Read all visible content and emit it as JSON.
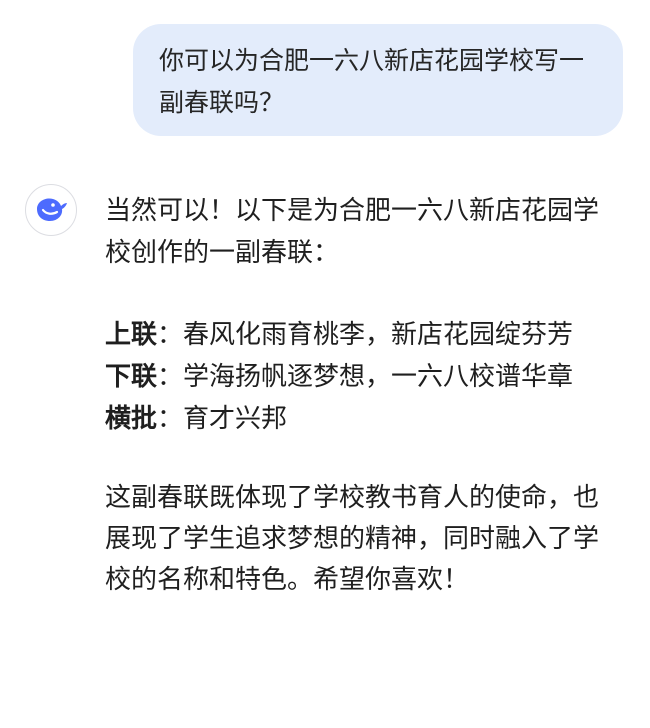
{
  "user_message": {
    "text": "你可以为合肥一六八新店花园学校写一副春联吗？"
  },
  "assistant": {
    "avatar_icon": "whale-logo-icon",
    "avatar_color": "#4d6bfe",
    "intro": "当然可以！以下是为合肥一六八新店花园学校创作的一副春联：",
    "couplet": {
      "upper_label": "上联",
      "upper_sep": "：",
      "upper_text": "春风化雨育桃李，新店花园绽芬芳",
      "lower_label": "下联",
      "lower_sep": "：",
      "lower_text": "学海扬帆逐梦想，一六八校谱华章",
      "horizontal_label": "横批",
      "horizontal_sep": "：",
      "horizontal_text": "育才兴邦"
    },
    "closing": "这副春联既体现了学校教书育人的使命，也展现了学生追求梦想的精神，同时融入了学校的名称和特色。希望你喜欢！"
  }
}
